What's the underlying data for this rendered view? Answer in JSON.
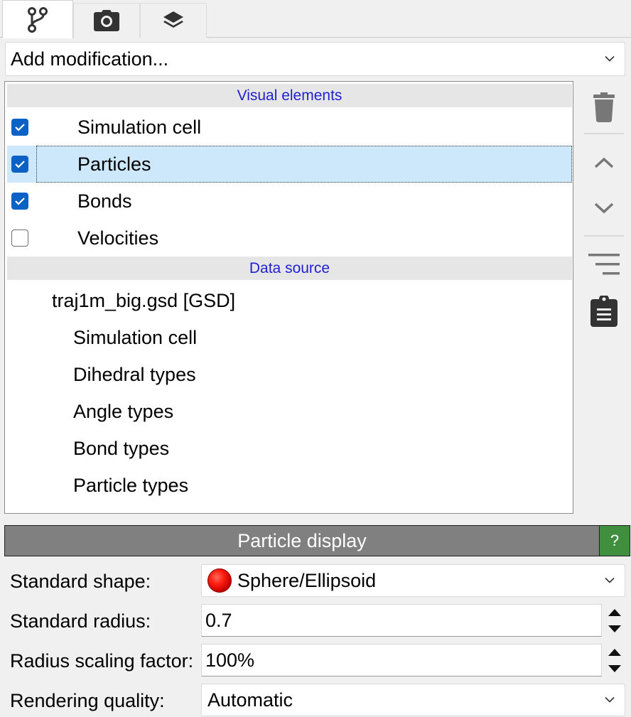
{
  "tabs": [
    {
      "icon": "pipeline-branch-icon",
      "active": true
    },
    {
      "icon": "camera-icon",
      "active": false
    },
    {
      "icon": "layers-icon",
      "active": false
    }
  ],
  "add_modification": {
    "value": "Add modification..."
  },
  "pipeline": {
    "visual_elements_header": "Visual elements",
    "visual_elements": [
      {
        "label": "Simulation cell",
        "checked": true,
        "selected": false
      },
      {
        "label": "Particles",
        "checked": true,
        "selected": true
      },
      {
        "label": "Bonds",
        "checked": true,
        "selected": false
      },
      {
        "label": "Velocities",
        "checked": false,
        "selected": false
      }
    ],
    "data_source_header": "Data source",
    "source_file": "traj1m_big.gsd [GSD]",
    "source_items": [
      "Simulation cell",
      "Dihedral types",
      "Angle types",
      "Bond types",
      "Particle types"
    ]
  },
  "toolbar": {
    "delete_icon": "trash-icon",
    "up_icon": "chevron-up-icon",
    "down_icon": "chevron-down-icon",
    "menu_icon": "menu-lines-icon",
    "clipboard_icon": "clipboard-icon"
  },
  "particle_display": {
    "title": "Particle display",
    "help": "?",
    "standard_shape_label": "Standard shape:",
    "standard_shape_value": "Sphere/Ellipsoid",
    "standard_radius_label": "Standard radius:",
    "standard_radius_value": "0.7",
    "radius_scaling_label": "Radius scaling factor:",
    "radius_scaling_value": "100%",
    "rendering_quality_label": "Rendering quality:",
    "rendering_quality_value": "Automatic"
  },
  "colors": {
    "checkbox": "#0b62c4",
    "selection": "#cde8fb",
    "section_header_text": "#1f1fcf",
    "help_button": "#3f8f3f",
    "panel_title_bg": "#808080"
  }
}
